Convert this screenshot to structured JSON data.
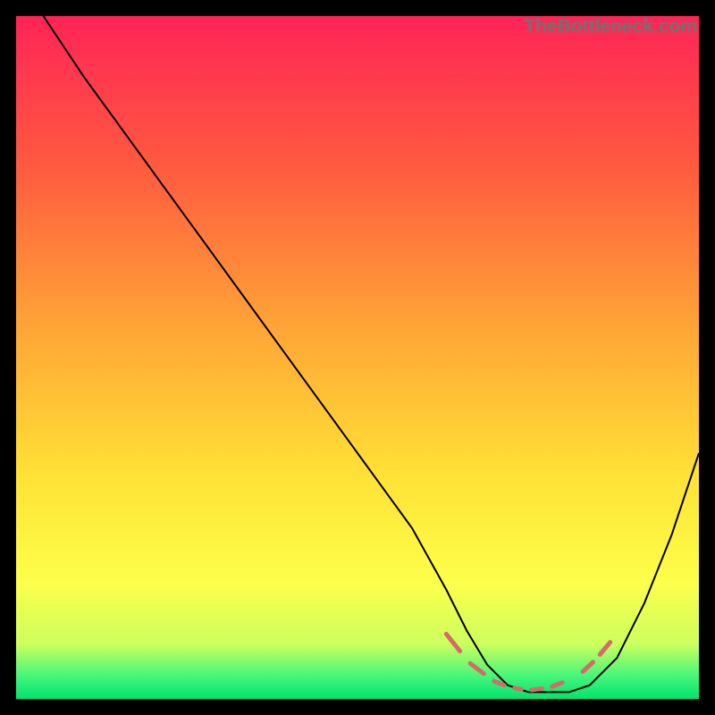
{
  "watermark": "TheBottleneck.com",
  "chart_data": {
    "type": "line",
    "title": "",
    "xlabel": "",
    "ylabel": "",
    "xlim": [
      0,
      100
    ],
    "ylim": [
      0,
      100
    ],
    "grid": false,
    "series": [
      {
        "name": "bottleneck-curve",
        "x": [
          4,
          10,
          18,
          26,
          34,
          42,
          50,
          58,
          63,
          66,
          69,
          72,
          75,
          78,
          81,
          84,
          88,
          92,
          96,
          100
        ],
        "y": [
          100,
          91,
          80,
          69,
          58,
          47,
          36,
          25,
          16,
          10,
          5,
          2,
          1,
          1,
          1,
          2,
          6,
          14,
          24,
          36
        ],
        "color": "#000000"
      }
    ],
    "markers": {
      "name": "highlight-dashes",
      "color": "#d66a6a",
      "segments": [
        {
          "x1": 63,
          "y1": 9.5,
          "x2": 65,
          "y2": 7.0
        },
        {
          "x1": 66.5,
          "y1": 5.2,
          "x2": 68.5,
          "y2": 3.7
        },
        {
          "x1": 70,
          "y1": 2.6,
          "x2": 71.5,
          "y2": 2.0
        },
        {
          "x1": 73,
          "y1": 1.6,
          "x2": 74,
          "y2": 1.4
        },
        {
          "x1": 75.5,
          "y1": 1.3,
          "x2": 77,
          "y2": 1.5
        },
        {
          "x1": 78.5,
          "y1": 1.8,
          "x2": 80,
          "y2": 2.4
        },
        {
          "x1": 83,
          "y1": 4.0,
          "x2": 84.5,
          "y2": 5.4
        },
        {
          "x1": 85.5,
          "y1": 6.5,
          "x2": 87,
          "y2": 8.3
        }
      ]
    },
    "gradient_stops": [
      {
        "offset": 0.0,
        "color": "#ff2457"
      },
      {
        "offset": 0.22,
        "color": "#ff5a3f"
      },
      {
        "offset": 0.46,
        "color": "#ffa636"
      },
      {
        "offset": 0.68,
        "color": "#ffe336"
      },
      {
        "offset": 0.83,
        "color": "#fdff4a"
      },
      {
        "offset": 0.92,
        "color": "#ccff5e"
      },
      {
        "offset": 0.965,
        "color": "#49f77a"
      },
      {
        "offset": 1.0,
        "color": "#00e46e"
      }
    ]
  }
}
